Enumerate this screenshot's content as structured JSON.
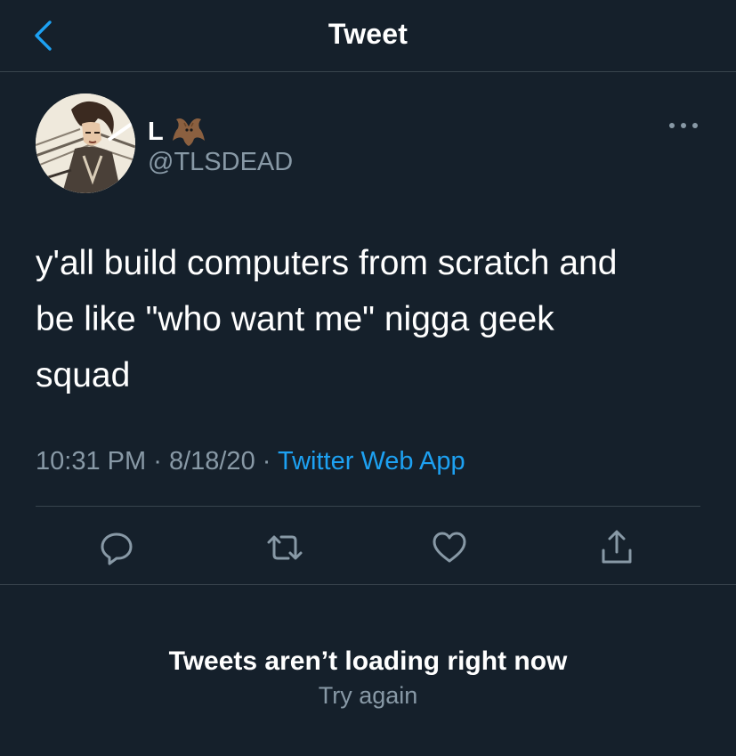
{
  "header": {
    "title": "Tweet",
    "back_icon": "chevron-left-icon",
    "accent_color": "#1da1f2"
  },
  "tweet": {
    "author": {
      "display_name": "L",
      "name_emoji": "bat-icon",
      "handle": "@TLSDEAD",
      "avatar": "avatar-anime-illustration"
    },
    "text": "y'all build computers from scratch and\nbe like \"who want me\" nigga geek\nsquad",
    "time": "10:31 PM",
    "separator": "·",
    "date": "8/18/20",
    "source": "Twitter Web App",
    "more_icon": "more-dots-icon"
  },
  "actions": [
    {
      "name": "reply",
      "icon": "reply-icon"
    },
    {
      "name": "retweet",
      "icon": "retweet-icon"
    },
    {
      "name": "like",
      "icon": "heart-icon"
    },
    {
      "name": "share",
      "icon": "share-icon"
    }
  ],
  "error": {
    "title": "Tweets aren’t loading right now",
    "retry_label": "Try again"
  },
  "colors": {
    "background": "#15202b",
    "divider": "#38444d",
    "secondary_text": "#8899a6",
    "primary_text": "#ffffff"
  }
}
